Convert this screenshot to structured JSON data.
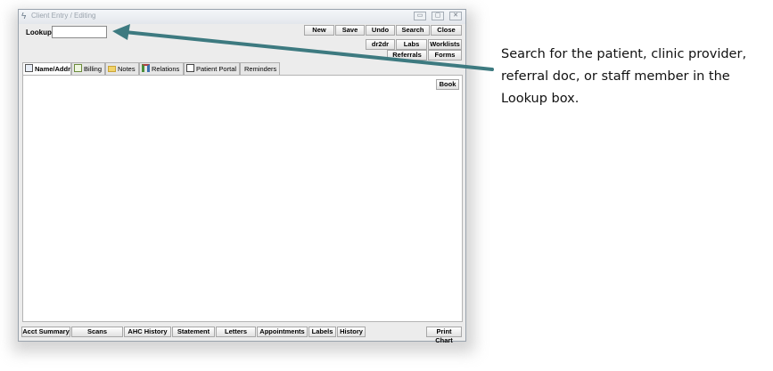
{
  "window": {
    "title": "Client Entry / Editing",
    "controls": {
      "minimize": "▭",
      "maximize": "▢",
      "close": "✕"
    }
  },
  "lookup": {
    "label": "Lookup:",
    "value": "",
    "placeholder": ""
  },
  "toolbar": {
    "row1": [
      "New",
      "Save",
      "Undo",
      "Search",
      "Close"
    ],
    "row2": [
      "dr2dr",
      "Labs",
      "Worklists"
    ],
    "row3": [
      "Referrals",
      "Forms"
    ]
  },
  "tabs": [
    {
      "label": "Name/Addr",
      "icon": "id-card-icon",
      "active": true
    },
    {
      "label": "Billing",
      "icon": "document-icon",
      "active": false
    },
    {
      "label": "Notes",
      "icon": "folder-icon",
      "active": false
    },
    {
      "label": "Relations",
      "icon": "relations-tree-icon",
      "active": false
    },
    {
      "label": "Patient Portal",
      "icon": "portal-icon",
      "active": false
    },
    {
      "label": "Reminders",
      "icon": "",
      "active": false
    }
  ],
  "panel": {
    "book_label": "Book"
  },
  "bottom_buttons": [
    "Acct Summary",
    "Scans",
    "AHC History",
    "Statement",
    "Letters",
    "Appointments",
    "Labels",
    "History"
  ],
  "print_chart_label": "Print Chart",
  "annotation": {
    "text": "Search for the patient, clinic provider, referral doc, or staff member in the Lookup box.",
    "line1": "Search for the patient, clinic provider,",
    "line2": "referral doc, or staff member in the",
    "line3": "Lookup box.",
    "arrow_color": "#3d7a80"
  }
}
